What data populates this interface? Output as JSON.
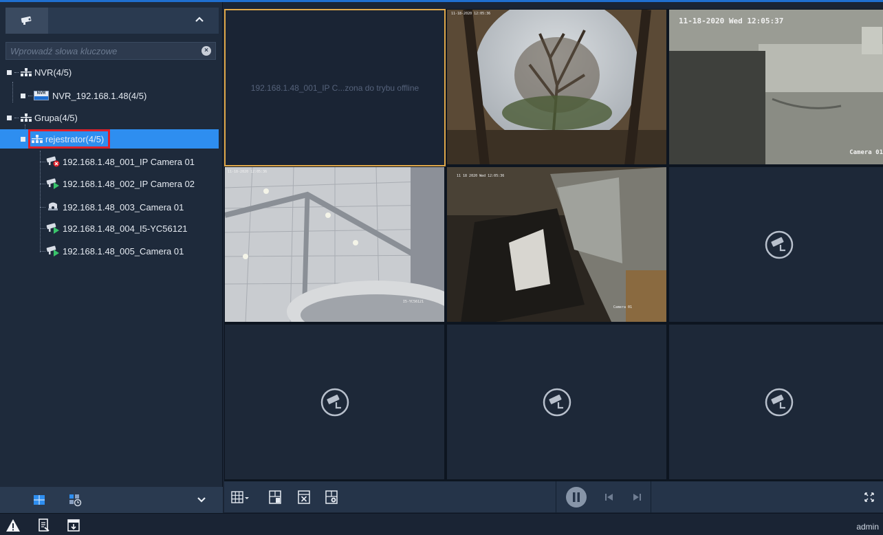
{
  "sidebar": {
    "search_placeholder": "Wprowadź słowa kluczowe",
    "tree": {
      "nvr_group": "NVR(4/5)",
      "nvr_device": "NVR_192.168.1.48(4/5)",
      "nvr_badge": "NVR",
      "group": "Grupa(4/5)",
      "recorder": "rejestrator(4/5)",
      "cameras": [
        {
          "label": "192.168.1.48_001_IP Camera 01",
          "status": "offline"
        },
        {
          "label": "192.168.1.48_002_IP Camera 02",
          "status": "online"
        },
        {
          "label": "192.168.1.48_003_Camera 01",
          "status": "idle"
        },
        {
          "label": "192.168.1.48_004_I5-YC56121",
          "status": "online"
        },
        {
          "label": "192.168.1.48_005_Camera 01",
          "status": "online"
        }
      ]
    }
  },
  "grid": {
    "tiles": [
      {
        "type": "offline",
        "message": "192.168.1.48_001_IP C...zona do trybu offline"
      },
      {
        "type": "video",
        "scene": "tree-sky",
        "osd_time": "11-18-2020 12:05:36"
      },
      {
        "type": "video",
        "scene": "gray-room",
        "osd_time": "11-18-2020 Wed 12:05:37",
        "osd_name": "Camera 01"
      },
      {
        "type": "video",
        "scene": "ceiling",
        "osd_time": "11-18-2020 12:05:36",
        "osd_name": "I5-YC56121"
      },
      {
        "type": "video",
        "scene": "office",
        "osd_time": "11 18 2020 Wed 12:05:36",
        "osd_name": "Camera 01"
      },
      {
        "type": "empty"
      },
      {
        "type": "empty"
      },
      {
        "type": "empty"
      },
      {
        "type": "empty"
      }
    ]
  },
  "status": {
    "user": "admin"
  },
  "colors": {
    "accent": "#2e8ef0",
    "highlight_box": "#e0202a",
    "active_tile_border": "#e2a94a",
    "online": "#39c46b",
    "offline": "#e0202a"
  }
}
